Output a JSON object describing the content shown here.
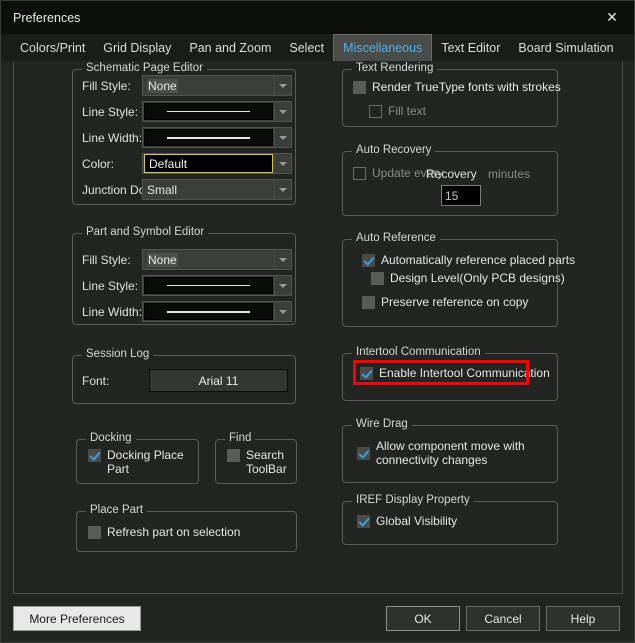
{
  "window": {
    "title": "Preferences",
    "close_icon": "close-icon"
  },
  "tabs": [
    {
      "label": "Colors/Print",
      "active": false
    },
    {
      "label": "Grid Display",
      "active": false
    },
    {
      "label": "Pan and Zoom",
      "active": false
    },
    {
      "label": "Select",
      "active": false
    },
    {
      "label": "Miscellaneous",
      "active": true
    },
    {
      "label": "Text Editor",
      "active": false
    },
    {
      "label": "Board Simulation",
      "active": false
    }
  ],
  "groups": {
    "schematic_page_editor": {
      "legend": "Schematic Page Editor",
      "fill_style_label": "Fill Style:",
      "fill_style_value": "None",
      "line_style_label": "Line Style:",
      "line_width_label": "Line Width:",
      "color_label": "Color:",
      "color_value": "Default",
      "junction_dot_label": "Junction Dot Size:",
      "junction_dot_value": "Small"
    },
    "part_and_symbol_editor": {
      "legend": "Part and Symbol Editor",
      "fill_style_label": "Fill Style:",
      "fill_style_value": "None",
      "line_style_label": "Line Style:",
      "line_width_label": "Line Width:"
    },
    "session_log": {
      "legend": "Session Log",
      "font_label": "Font:",
      "font_value": "Arial 11"
    },
    "docking": {
      "legend": "Docking",
      "docking_place_part_label": "Docking Place Part",
      "docking_place_part_checked": true
    },
    "find": {
      "legend": "Find",
      "search_toolbar_label": "Search ToolBar",
      "search_toolbar_checked": false
    },
    "place_part": {
      "legend": "Place Part",
      "refresh_label": "Refresh part on selection",
      "refresh_checked": false
    },
    "text_rendering": {
      "legend": "Text Rendering",
      "render_truetype_label": "Render TrueType fonts with strokes",
      "render_truetype_checked": false,
      "fill_text_label": "Fill text",
      "fill_text_checked": false,
      "fill_text_disabled": true
    },
    "auto_recovery": {
      "legend": "Auto Recovery",
      "update_every_label": "Update every",
      "overlay_label": "Recovery",
      "minutes_label": "minutes",
      "interval_value": "15",
      "update_every_checked": false,
      "update_every_disabled": true
    },
    "auto_reference": {
      "legend": "Auto Reference",
      "auto_ref_label": "Automatically reference placed parts",
      "auto_ref_checked": true,
      "design_level_label": "Design Level(Only PCB designs)",
      "design_level_checked": false,
      "preserve_label": "Preserve reference on copy",
      "preserve_checked": false
    },
    "intertool_communication": {
      "legend": "Intertool Communication",
      "enable_label": "Enable Intertool Communication",
      "enable_checked": true,
      "highlight_color": "#ff0000"
    },
    "wire_drag": {
      "legend": "Wire Drag",
      "allow_move_label": "Allow component move with connectivity changes",
      "allow_move_checked": true
    },
    "iref_display_property": {
      "legend": "IREF Display Property",
      "global_visibility_label": "Global Visibility",
      "global_visibility_checked": true
    }
  },
  "footer": {
    "more_preferences": "More Preferences",
    "ok": "OK",
    "cancel": "Cancel",
    "help": "Help"
  }
}
